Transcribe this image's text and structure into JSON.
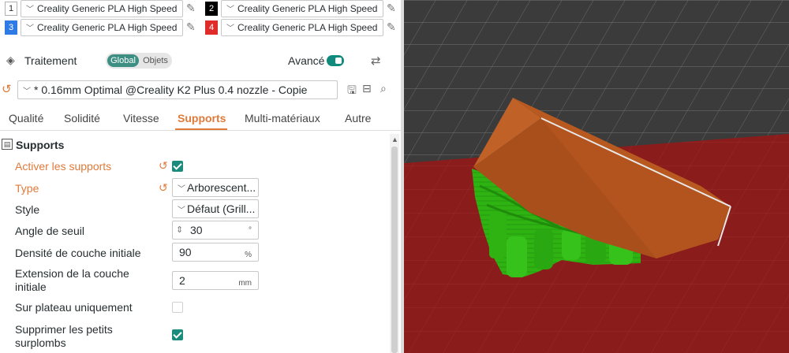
{
  "filaments": [
    {
      "num": "1",
      "color": "#ffffff",
      "num_text_color": "#262e30",
      "name": "Creality Generic PLA High Speed"
    },
    {
      "num": "2",
      "color": "#000000",
      "num_text_color": "#ffffff",
      "name": "Creality Generic PLA High Speed"
    },
    {
      "num": "3",
      "color": "#2e7be6",
      "num_text_color": "#ffffff",
      "name": "Creality Generic PLA High Speed"
    },
    {
      "num": "4",
      "color": "#e02b2b",
      "num_text_color": "#ffffff",
      "name": "Creality Generic PLA High Speed"
    }
  ],
  "process": {
    "title": "Traitement",
    "scope_global": "Global",
    "scope_objets": "Objets",
    "advanced_label": "Avancé",
    "advanced_on": true
  },
  "preset": {
    "name": "* 0.16mm Optimal @Creality K2 Plus 0.4 nozzle - Copie"
  },
  "tabs": [
    {
      "label": "Qualité",
      "active": false
    },
    {
      "label": "Solidité",
      "active": false
    },
    {
      "label": "Vitesse",
      "active": false
    },
    {
      "label": "Supports",
      "active": true
    },
    {
      "label": "Multi-matériaux",
      "active": false
    },
    {
      "label": "Autre",
      "active": false
    }
  ],
  "section": {
    "title": "Supports",
    "options": {
      "enable": {
        "label": "Activer les supports",
        "checked": true,
        "changed": true
      },
      "type": {
        "label": "Type",
        "value": "Arborescent...",
        "changed": true
      },
      "style": {
        "label": "Style",
        "value": "Défaut (Grill..."
      },
      "threshold": {
        "label": "Angle de seuil",
        "value": "30",
        "unit": "°"
      },
      "first_layer_density": {
        "label": "Densité de couche initiale",
        "value": "90",
        "unit": "%"
      },
      "first_layer_expansion": {
        "label_line1": "Extension de la couche",
        "label_line2": "initiale",
        "value": "2",
        "unit": "mm"
      },
      "on_build_plate_only": {
        "label": "Sur plateau uniquement",
        "checked": false
      },
      "remove_small_overhangs": {
        "label_line1": "Supprimer les petits",
        "label_line2": "surplombs",
        "checked": true
      }
    }
  },
  "colors": {
    "accent": "#e07a3a",
    "teal": "#1b8c7c",
    "bed": "#8b1c1c",
    "model": "#b4541f",
    "support": "#2fb313"
  },
  "icons": {
    "filament_edit": "pencil-icon",
    "process": "layers-icon",
    "compare": "compare-icon",
    "reset": "undo-icon",
    "save": "save-icon",
    "delete": "minus-box-icon",
    "search": "search-icon"
  }
}
